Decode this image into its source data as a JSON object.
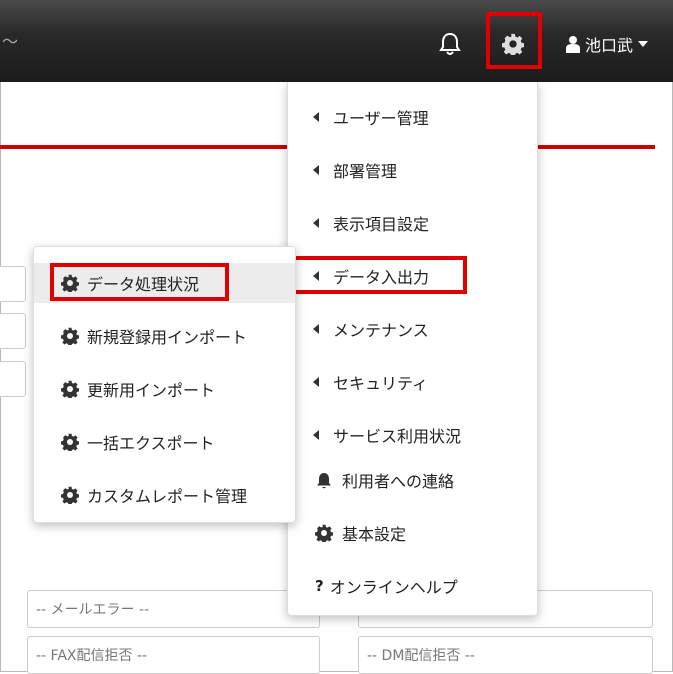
{
  "header": {
    "crumb": "〜",
    "user_name": "池口武"
  },
  "admin_menu": {
    "items": [
      {
        "label": "ユーザー管理"
      },
      {
        "label": "部署管理"
      },
      {
        "label": "表示項目設定"
      },
      {
        "label": "データ入出力"
      },
      {
        "label": "メンテナンス"
      },
      {
        "label": "セキュリティ"
      },
      {
        "label": "サービス利用状況"
      },
      {
        "label": "利用者への連絡"
      },
      {
        "label": "基本設定"
      },
      {
        "label": "オンラインヘルプ"
      }
    ],
    "help_mark": "?"
  },
  "data_submenu": {
    "items": [
      {
        "label": "データ処理状況"
      },
      {
        "label": "新規登録用インポート"
      },
      {
        "label": "更新用インポート"
      },
      {
        "label": "一括エクスポート"
      },
      {
        "label": "カスタムレポート管理"
      }
    ]
  },
  "form": {
    "mail_error": "-- メールエラー --",
    "fax_refusal": "-- FAX配信拒否 --",
    "dm_refusal": "-- DM配信拒否 --"
  },
  "colors": {
    "highlight": "#e00000",
    "accent_line": "#cc0000",
    "topbar": "#1b1b1b"
  }
}
